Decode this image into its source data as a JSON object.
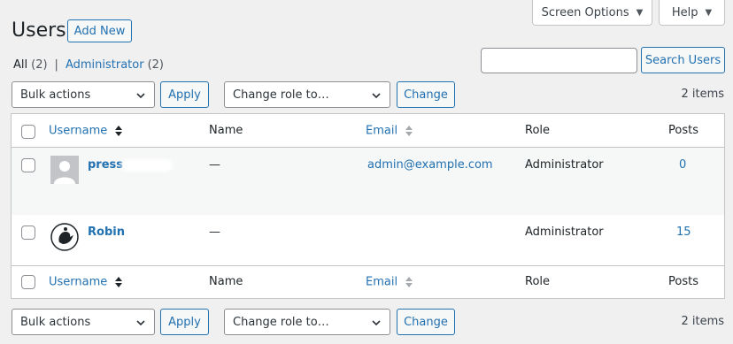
{
  "header": {
    "screen_options_label": "Screen Options",
    "help_label": "Help",
    "title": "Users",
    "add_new_label": "Add New"
  },
  "views": {
    "all_label": "All",
    "all_count": "(2)",
    "separator": "|",
    "administrator_label": "Administrator",
    "administrator_count": "(2)"
  },
  "search": {
    "value": "",
    "button_label": "Search Users"
  },
  "tablenav_top": {
    "bulk_actions": "Bulk actions",
    "apply_label": "Apply",
    "change_role": "Change role to…",
    "change_label": "Change",
    "items_count": "2 items"
  },
  "tablenav_bottom": {
    "bulk_actions": "Bulk actions",
    "apply_label": "Apply",
    "change_role": "Change role to…",
    "change_label": "Change",
    "items_count": "2 items"
  },
  "table": {
    "columns": {
      "username": "Username",
      "name": "Name",
      "email": "Email",
      "role": "Role",
      "posts": "Posts"
    },
    "rows": [
      {
        "username": "press",
        "name": "—",
        "email": "admin@example.com",
        "role": "Administrator",
        "posts": "0"
      },
      {
        "username": "Robin",
        "name": "—",
        "email": "",
        "role": "Administrator",
        "posts": "15"
      }
    ]
  },
  "colors": {
    "link": "#2271b1",
    "background": "#f0f0f1",
    "border": "#c3c4c7"
  }
}
